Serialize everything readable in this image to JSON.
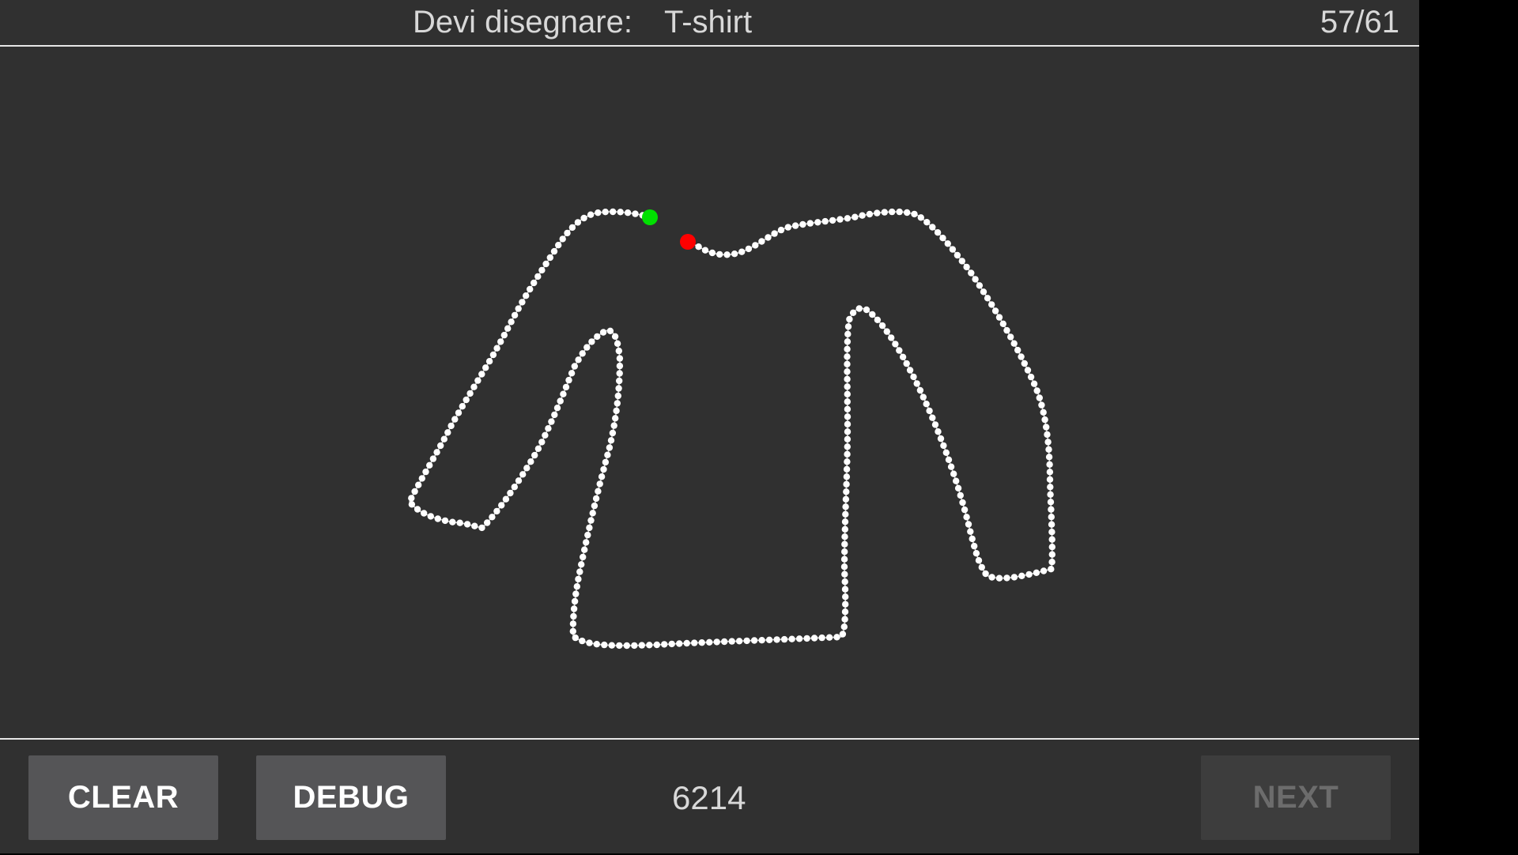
{
  "header": {
    "prompt_label": "Devi disegnare:",
    "prompt_object": "T-shirt",
    "progress": "57/61"
  },
  "footer": {
    "clear_label": "CLEAR",
    "debug_label": "DEBUG",
    "score": "6214",
    "next_label": "NEXT"
  },
  "colors": {
    "background": "#303030",
    "stroke": "#ffffff",
    "start_point": "#00e000",
    "end_point": "#ff0000",
    "button": "#555557",
    "button_disabled": "#3d3d3d"
  }
}
